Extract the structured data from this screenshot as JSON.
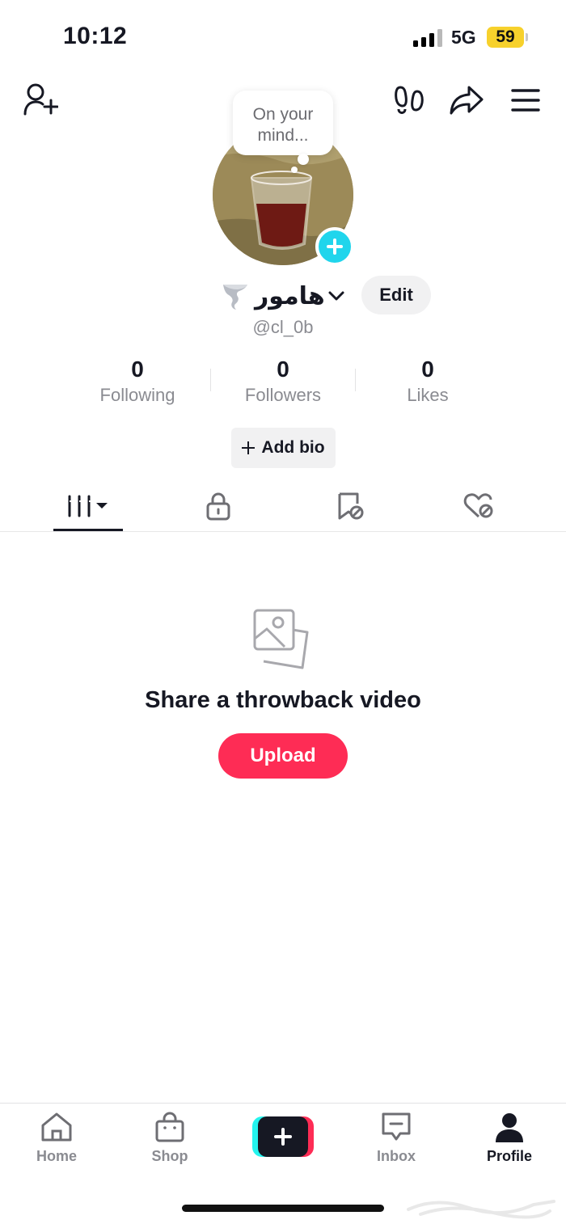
{
  "status_bar": {
    "time": "10:12",
    "network": "5G",
    "battery": "59"
  },
  "header": {
    "left_icon": "add-friend-icon",
    "right_icons": [
      "footprints-icon",
      "share-icon",
      "menu-icon"
    ]
  },
  "profile": {
    "thought_bubble": [
      "On your",
      "mind..."
    ],
    "display_name": "هامور",
    "name_emoji": "tornado-icon",
    "edit_label": "Edit",
    "username": "@cl_0b",
    "stats": [
      {
        "value": "0",
        "label": "Following"
      },
      {
        "value": "0",
        "label": "Followers"
      },
      {
        "value": "0",
        "label": "Likes"
      }
    ],
    "add_bio_label": "Add bio"
  },
  "tabs": [
    {
      "icon": "videos-grid-icon",
      "active": true
    },
    {
      "icon": "lock-icon",
      "active": false
    },
    {
      "icon": "bookmark-icon",
      "active": false
    },
    {
      "icon": "liked-heart-icon",
      "active": false
    }
  ],
  "empty_state": {
    "icon": "photos-icon",
    "title": "Share a throwback video",
    "button_label": "Upload"
  },
  "bottom_nav": [
    {
      "label": "Home",
      "icon": "home-icon"
    },
    {
      "label": "Shop",
      "icon": "shop-bag-icon"
    },
    {
      "label": "",
      "icon": "create-plus-icon"
    },
    {
      "label": "Inbox",
      "icon": "inbox-icon"
    },
    {
      "label": "Profile",
      "icon": "profile-icon",
      "active": true
    }
  ],
  "colors": {
    "accent": "#fe2c55",
    "cyan": "#20d5ec",
    "text": "#161823",
    "muted": "#8a8b91",
    "battery": "#f7d12c"
  }
}
